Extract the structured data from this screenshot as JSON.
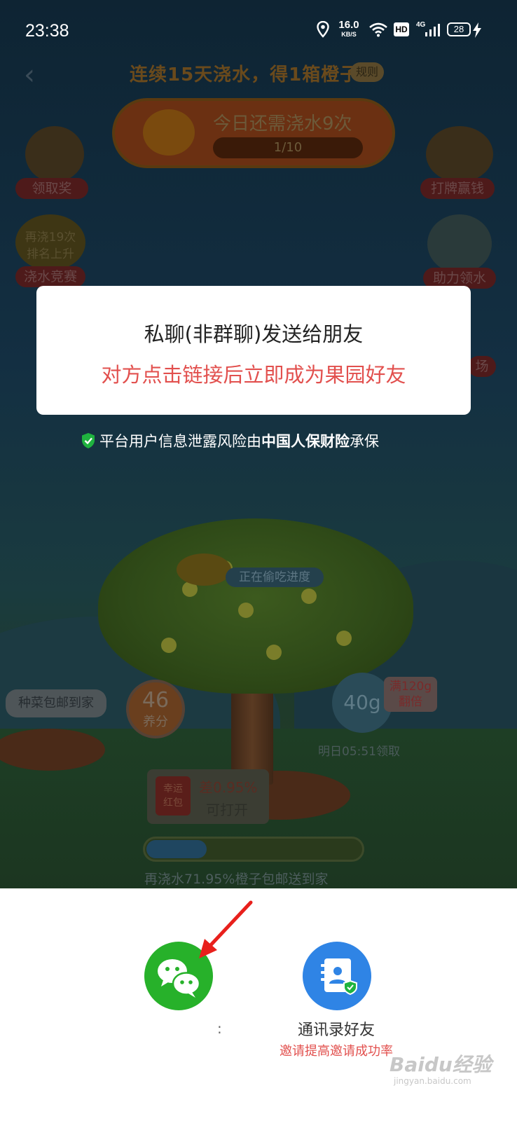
{
  "status_bar": {
    "time": "23:38",
    "net_speed": "16.0",
    "net_unit": "KB/S",
    "hd": "HD",
    "network": "4G",
    "battery": "28"
  },
  "game": {
    "header_title": "连续15天浇水，得1箱橙子",
    "rules": "规则",
    "water_needed": "今日还需浇水9次",
    "water_progress": "1/10",
    "left_buttons": [
      "领取奖",
      "浇水竞赛"
    ],
    "rank_badge_line1": "再浇19次",
    "rank_badge_line2": "排名上升",
    "right_buttons": [
      "打牌赢钱",
      "助力领水",
      "场"
    ],
    "steal_ticker": "正在偷吃进度",
    "veg_label": "种菜包邮到家",
    "score_value": "46",
    "score_unit": "养分",
    "kettle_value": "40g",
    "double_line1": "满120g",
    "double_line2": "翻倍",
    "tomorrow": "明日05:51领取",
    "lucky_line1": "幸运",
    "lucky_line2": "红包",
    "lucky_diff": "差0.95%",
    "lucky_open": "可打开",
    "progress_fraction": 0.28,
    "progress_caption": "再浇水71.95%橙子包邮送到家"
  },
  "dialog": {
    "line1": "私聊(非群聊)发送给朋友",
    "line2": "对方点击链接后立即成为果园好友"
  },
  "insurance": {
    "prefix": "平台用户信息泄露风险由",
    "company": "中国人保财险",
    "suffix": "承保"
  },
  "share_sheet": {
    "wechat_label": ":",
    "contacts_label": "通讯录好友",
    "contacts_sub": "邀请提高邀请成功率"
  },
  "watermark": {
    "brand": "Baidu经验",
    "url": "jingyan.baidu.com"
  },
  "colors": {
    "wechat_green": "#27b12a",
    "contacts_blue": "#2f84e5",
    "accent_red": "#e2504e",
    "annotation_red": "#e8201c"
  }
}
